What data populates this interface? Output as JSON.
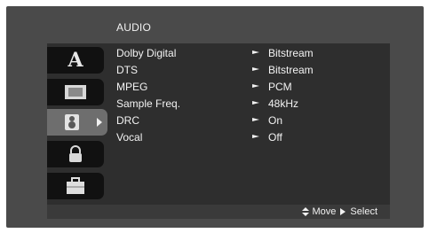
{
  "menu": {
    "title": "AUDIO",
    "rows": [
      {
        "label": "Dolby Digital",
        "value": "Bitstream"
      },
      {
        "label": "DTS",
        "value": "Bitstream"
      },
      {
        "label": "MPEG",
        "value": "PCM"
      },
      {
        "label": "Sample Freq.",
        "value": "48kHz"
      },
      {
        "label": "DRC",
        "value": "On"
      },
      {
        "label": "Vocal",
        "value": "Off"
      }
    ]
  },
  "sidebar": {
    "items": [
      {
        "name": "language",
        "icon": "letter-a-icon",
        "glyph": "A",
        "selected": false
      },
      {
        "name": "display",
        "icon": "display-icon",
        "selected": false
      },
      {
        "name": "audio",
        "icon": "speaker-icon",
        "selected": true
      },
      {
        "name": "lock",
        "icon": "lock-icon",
        "selected": false
      },
      {
        "name": "others",
        "icon": "toolbox-icon",
        "selected": false
      }
    ]
  },
  "footer": {
    "move_label": "Move",
    "select_label": "Select"
  },
  "colors": {
    "screen_bg": "#4a4a4a",
    "panel_bg": "#2e2e2e",
    "tile_bg": "#111111",
    "tile_selected": "#6e6e6e",
    "text": "#f3f3f3"
  }
}
